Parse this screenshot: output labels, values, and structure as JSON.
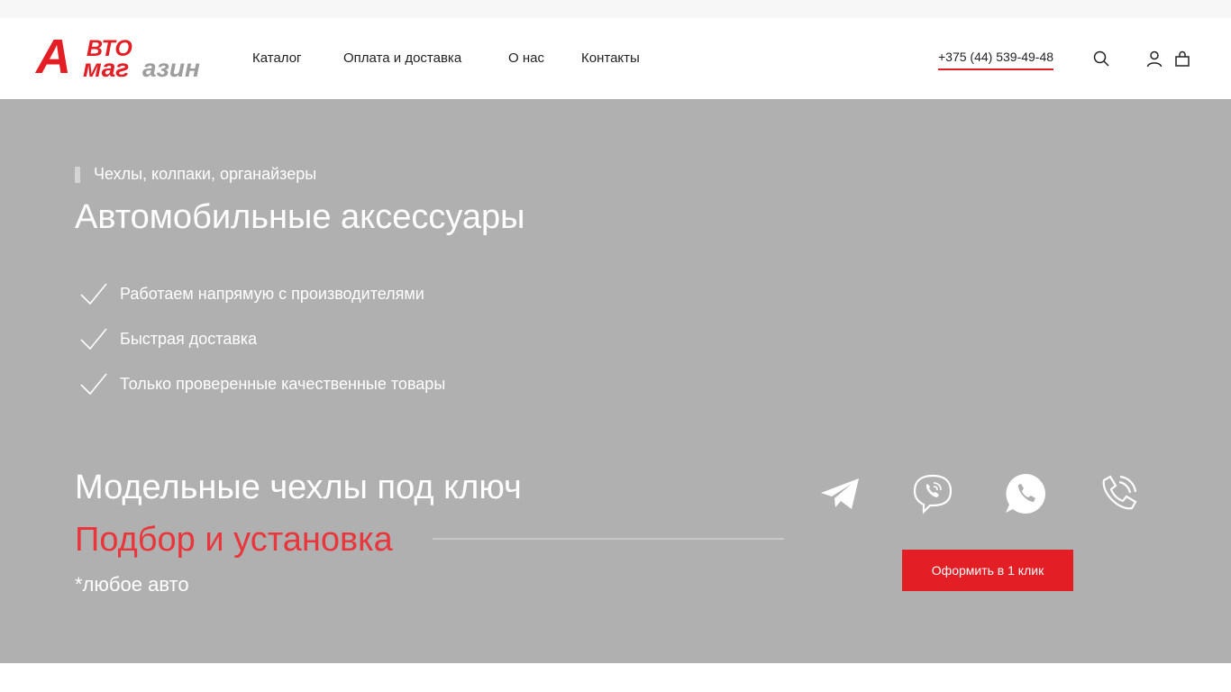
{
  "header": {
    "logo": {
      "letter": "А",
      "top": "ВТО",
      "mid_red": "маг",
      "mid_gray": "азин"
    },
    "nav": [
      {
        "label": "Каталог"
      },
      {
        "label": "Оплата и доставка"
      },
      {
        "label": "О нас"
      },
      {
        "label": "Контакты"
      }
    ],
    "phone": "+375 (44) 539-49-48",
    "icons": [
      "search-icon",
      "user-icon",
      "bag-icon"
    ]
  },
  "hero": {
    "eyebrow": "Чехлы, колпаки, органайзеры",
    "title": "Автомобильные аксессуары",
    "features": [
      "Работаем напрямую с производителями",
      "Быстрая доставка",
      "Только проверенные качественные товары"
    ],
    "promo_title": "Модельные чехлы под ключ",
    "promo_sub": "Подбор и установка",
    "promo_note": "*любое авто",
    "social": [
      "telegram-icon",
      "viber-icon",
      "whatsapp-icon",
      "phone-call-icon"
    ],
    "button": "Оформить в 1 клик"
  },
  "colors": {
    "accent": "#e31e24",
    "hero_bg": "#b0b0b0",
    "text_light": "#ffffff",
    "logo_gray": "#9d9d9d"
  }
}
